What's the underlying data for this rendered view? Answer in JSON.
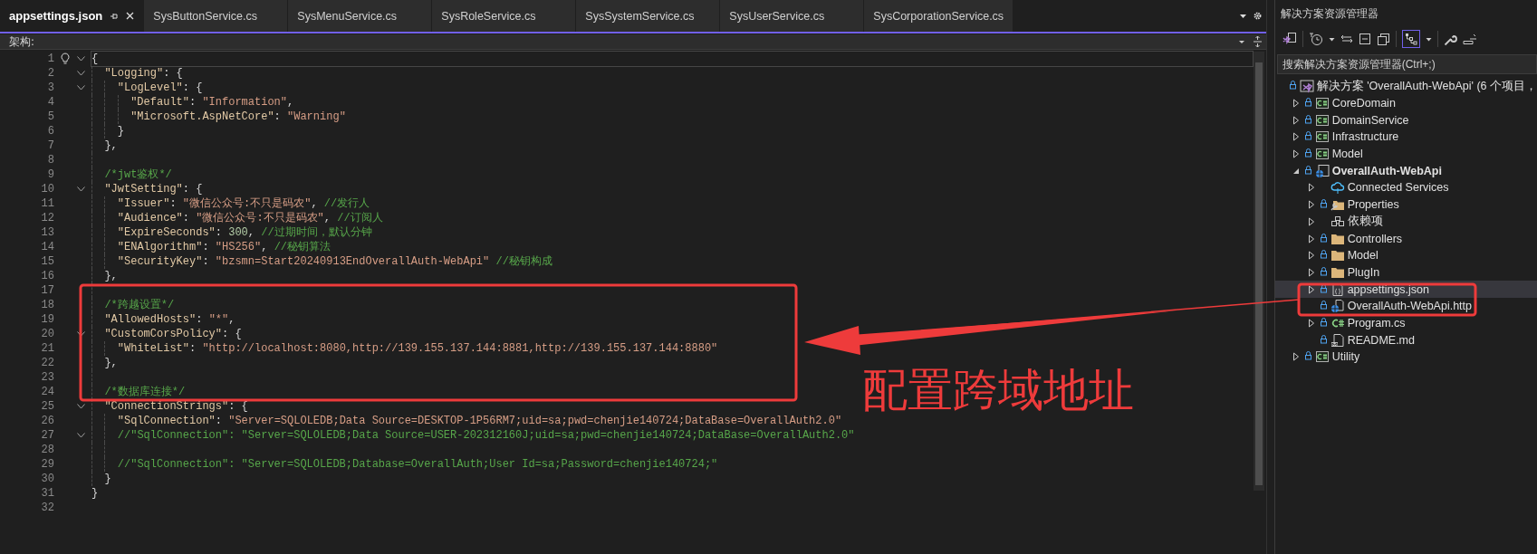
{
  "tabs": [
    {
      "label": "appsettings.json",
      "selected": true
    },
    {
      "label": "SysButtonService.cs",
      "selected": false
    },
    {
      "label": "SysMenuService.cs",
      "selected": false
    },
    {
      "label": "SysRoleService.cs",
      "selected": false
    },
    {
      "label": "SysSystemService.cs",
      "selected": false
    },
    {
      "label": "SysUserService.cs",
      "selected": false
    },
    {
      "label": "SysCorporationService.cs",
      "selected": false
    }
  ],
  "navbar": {
    "label": "架构:"
  },
  "editor": {
    "lines": [
      {
        "number": "1",
        "fold": true,
        "current": true,
        "tokens": [
          {
            "punct": "{"
          }
        ]
      },
      {
        "number": "2",
        "fold": true,
        "current": false,
        "tokens": [
          {
            "key": "\"Logging\""
          },
          {
            "punct": ": {"
          }
        ]
      },
      {
        "number": "3",
        "fold": true,
        "current": false,
        "tokens": [
          {
            "key": "\"LogLevel\""
          },
          {
            "punct": ": {"
          }
        ]
      },
      {
        "number": "4",
        "fold": false,
        "current": false,
        "tokens": [
          {
            "key": "\"Default\""
          },
          {
            "punct": ": "
          },
          {
            "string": "\"Information\""
          },
          {
            "punct": ","
          }
        ]
      },
      {
        "number": "5",
        "fold": false,
        "current": false,
        "tokens": [
          {
            "key": "\"Microsoft.AspNetCore\""
          },
          {
            "punct": ": "
          },
          {
            "string": "\"Warning\""
          }
        ]
      },
      {
        "number": "6",
        "fold": false,
        "current": false,
        "tokens": [
          {
            "punct": "}"
          }
        ]
      },
      {
        "number": "7",
        "fold": false,
        "current": false,
        "tokens": [
          {
            "punct": "},"
          }
        ]
      },
      {
        "number": "8",
        "fold": false,
        "current": false
      },
      {
        "number": "9",
        "fold": false,
        "current": false,
        "tokens": [
          {
            "comment": "/*jwt鉴权*/"
          }
        ]
      },
      {
        "number": "10",
        "fold": true,
        "current": false,
        "tokens": [
          {
            "key": "\"JwtSetting\""
          },
          {
            "punct": ": {"
          }
        ]
      },
      {
        "number": "11",
        "fold": false,
        "current": false,
        "tokens": [
          {
            "key": "\"Issuer\""
          },
          {
            "punct": ": "
          },
          {
            "string": "\"微信公众号:不只是码农\""
          },
          {
            "punct": ", "
          },
          {
            "comment": "//发行人"
          }
        ]
      },
      {
        "number": "12",
        "fold": false,
        "current": false,
        "tokens": [
          {
            "key": "\"Audience\""
          },
          {
            "punct": ": "
          },
          {
            "string": "\"微信公众号:不只是码农\""
          },
          {
            "punct": ", "
          },
          {
            "comment": "//订阅人"
          }
        ]
      },
      {
        "number": "13",
        "fold": false,
        "current": false,
        "tokens": [
          {
            "key": "\"ExpireSeconds\""
          },
          {
            "punct": ": "
          },
          {
            "number": "300"
          },
          {
            "punct": ", "
          },
          {
            "comment": "//过期时间，默认分钟"
          }
        ]
      },
      {
        "number": "14",
        "fold": false,
        "current": false,
        "tokens": [
          {
            "key": "\"ENAlgorithm\""
          },
          {
            "punct": ": "
          },
          {
            "string": "\"HS256\""
          },
          {
            "punct": ", "
          },
          {
            "comment": "//秘钥算法"
          }
        ]
      },
      {
        "number": "15",
        "fold": false,
        "current": false,
        "tokens": [
          {
            "key": "\"SecurityKey\""
          },
          {
            "punct": ": "
          },
          {
            "string": "\"bzsmn=Start20240913EndOverallAuth-WebApi\""
          },
          {
            "comment": "//秘钥构成"
          }
        ]
      },
      {
        "number": "16",
        "fold": false,
        "current": false,
        "tokens": [
          {
            "punct": "},"
          }
        ]
      },
      {
        "number": "17",
        "fold": false,
        "current": false
      },
      {
        "number": "18",
        "fold": false,
        "current": false,
        "tokens": [
          {
            "comment": "/*跨越设置*/"
          }
        ]
      },
      {
        "number": "19",
        "fold": false,
        "current": false,
        "tokens": [
          {
            "key": "\"AllowedHosts\""
          },
          {
            "punct": ": "
          },
          {
            "string": "\"*\""
          },
          {
            "punct": ","
          }
        ]
      },
      {
        "number": "20",
        "fold": true,
        "current": false,
        "tokens": [
          {
            "key": "\"CustomCorsPolicy\""
          },
          {
            "punct": ": {"
          }
        ]
      },
      {
        "number": "21",
        "fold": false,
        "current": false,
        "tokens": [
          {
            "key": "\"WhiteList\""
          },
          {
            "punct": ": "
          },
          {
            "string": "\"http://localhost:8080,http://139.155.137.144:8881,http://139.155.137.144:8880\""
          }
        ]
      },
      {
        "number": "22",
        "fold": false,
        "current": false,
        "tokens": [
          {
            "punct": "},"
          }
        ]
      },
      {
        "number": "23",
        "fold": false,
        "current": false
      },
      {
        "number": "24",
        "fold": false,
        "current": false,
        "tokens": [
          {
            "comment": "/*数据库连接*/"
          }
        ]
      },
      {
        "number": "25",
        "fold": true,
        "current": false,
        "tokens": [
          {
            "key": "\"ConnectionStrings\""
          },
          {
            "punct": ": {"
          }
        ]
      },
      {
        "number": "26",
        "fold": false,
        "current": false,
        "tokens": [
          {
            "key": "\"SqlConnection\""
          },
          {
            "punct": ": "
          },
          {
            "string": "\"Server=SQLOLEDB;Data Source=DESKTOP-1P56RM7;uid=sa;pwd=chenjie140724;DataBase=OverallAuth2.0\""
          }
        ]
      },
      {
        "number": "27",
        "fold": true,
        "current": false,
        "tokens": [
          {
            "comment": "//\"SqlConnection\": \"Server=SQLOLEDB;Data Source=USER-202312160J;uid=sa;pwd=chenjie140724;DataBase=OverallAuth2.0\""
          }
        ]
      },
      {
        "number": "28",
        "fold": false,
        "current": false
      },
      {
        "number": "29",
        "fold": false,
        "current": false,
        "tokens": [
          {
            "comment": "//\"SqlConnection\": \"Server=SQLOLEDB;Database=OverallAuth;User Id=sa;Password=chenjie140724;\""
          }
        ]
      },
      {
        "number": "30",
        "fold": false,
        "current": false,
        "tokens": [
          {
            "punct": "}"
          }
        ]
      },
      {
        "number": "31",
        "fold": false,
        "current": false,
        "tokens": [
          {
            "punct": "}"
          }
        ]
      },
      {
        "number": "32",
        "fold": false,
        "current": false
      }
    ]
  },
  "explorer": {
    "title": "解决方案资源管理器",
    "search": {
      "placeholder": "搜索解决方案资源管理器(Ctrl+;)"
    },
    "tree": [
      {
        "label": "解决方案 'OverallAuth-WebApi' (6 个项目，",
        "kind": "solution",
        "locked": true,
        "selected": false,
        "children": [
          {
            "label": "CoreDomain",
            "kind": "csproj",
            "locked": true,
            "expanded": false,
            "startup": false,
            "selected": false
          },
          {
            "label": "DomainService",
            "kind": "csproj",
            "locked": true,
            "expanded": false,
            "startup": false,
            "selected": false
          },
          {
            "label": "Infrastructure",
            "kind": "csproj",
            "locked": true,
            "expanded": false,
            "startup": false,
            "selected": false
          },
          {
            "label": "Model",
            "kind": "csproj",
            "locked": true,
            "expanded": false,
            "startup": false,
            "selected": false
          },
          {
            "label": "OverallAuth-WebApi",
            "kind": "webproj",
            "locked": true,
            "expanded": true,
            "startup": true,
            "selected": false,
            "children": [
              {
                "label": "Connected Services",
                "kind": "cloud",
                "locked": false,
                "expanded": false,
                "selected": false
              },
              {
                "label": "Properties",
                "kind": "propfolder",
                "locked": true,
                "expanded": false,
                "selected": false
              },
              {
                "label": "依赖项",
                "kind": "deps",
                "locked": false,
                "expanded": false,
                "selected": false
              },
              {
                "label": "Controllers",
                "kind": "folder",
                "locked": true,
                "expanded": false,
                "selected": false
              },
              {
                "label": "Model",
                "kind": "folder",
                "locked": true,
                "expanded": false,
                "selected": false
              },
              {
                "label": "PlugIn",
                "kind": "folder",
                "locked": true,
                "expanded": false,
                "selected": false
              },
              {
                "label": "appsettings.json",
                "kind": "json",
                "locked": true,
                "expanded": false,
                "selected": true
              },
              {
                "label": "OverallAuth-WebApi.http",
                "kind": "http",
                "locked": true,
                "selected": false
              },
              {
                "label": "Program.cs",
                "kind": "cs",
                "locked": true,
                "expanded": false,
                "selected": false
              },
              {
                "label": "README.md",
                "kind": "md",
                "locked": true,
                "selected": false
              }
            ]
          },
          {
            "label": "Utility",
            "kind": "csproj",
            "locked": true,
            "expanded": false,
            "startup": false,
            "selected": false
          }
        ]
      }
    ]
  },
  "annotation": {
    "label": "配置跨域地址"
  }
}
